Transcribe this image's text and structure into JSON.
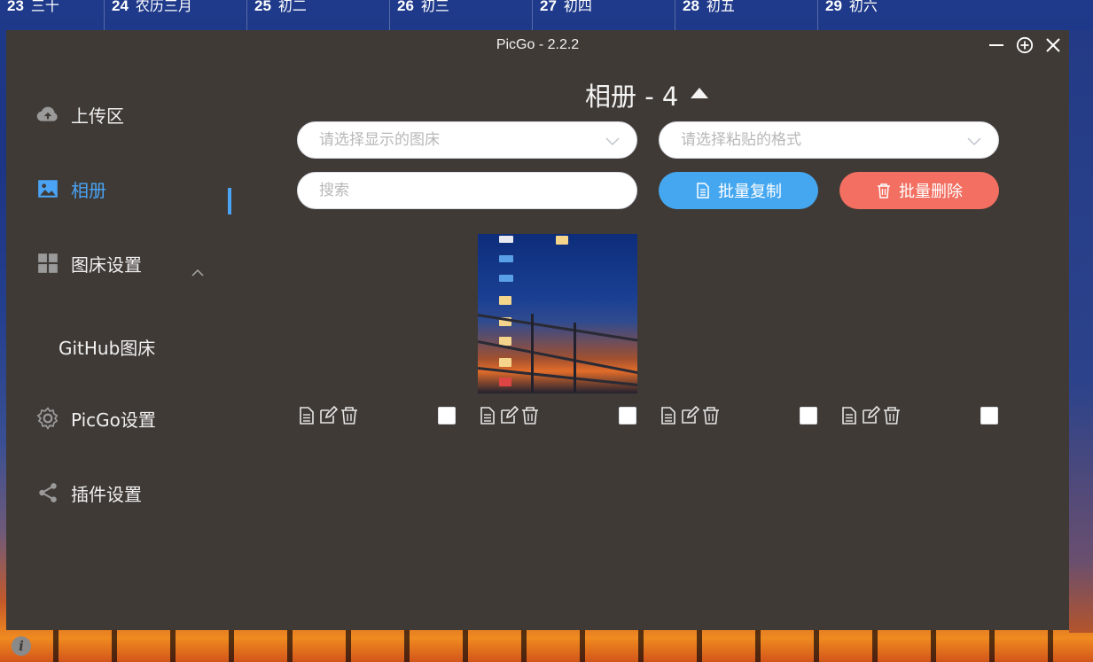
{
  "calendar": [
    {
      "day": "23",
      "lunar": "三十"
    },
    {
      "day": "24",
      "lunar": "农历三月"
    },
    {
      "day": "25",
      "lunar": "初二"
    },
    {
      "day": "26",
      "lunar": "初三"
    },
    {
      "day": "27",
      "lunar": "初四"
    },
    {
      "day": "28",
      "lunar": "初五"
    },
    {
      "day": "29",
      "lunar": "初六"
    }
  ],
  "window": {
    "title": "PicGo - 2.2.2"
  },
  "sidebar": {
    "items": [
      {
        "label": "上传区",
        "icon": "cloud-upload-icon"
      },
      {
        "label": "相册",
        "icon": "picture-icon"
      },
      {
        "label": "图床设置",
        "icon": "grid-icon"
      },
      {
        "label": "PicGo设置",
        "icon": "gear-icon"
      },
      {
        "label": "插件设置",
        "icon": "share-icon"
      }
    ],
    "subitems": [
      {
        "label": "GitHub图床"
      }
    ]
  },
  "gallery": {
    "title": "相册 - 4",
    "picbed_select": {
      "placeholder": "请选择显示的图床"
    },
    "paste_select": {
      "placeholder": "请选择粘贴的格式"
    },
    "search": {
      "placeholder": "搜索"
    },
    "copy_button": "批量复制",
    "delete_button": "批量删除",
    "card_count": 4
  },
  "colors": {
    "accent": "#4aa3f5",
    "copy": "#45a7f0",
    "delete": "#f26f61",
    "window_bg": "#3f3a36"
  }
}
